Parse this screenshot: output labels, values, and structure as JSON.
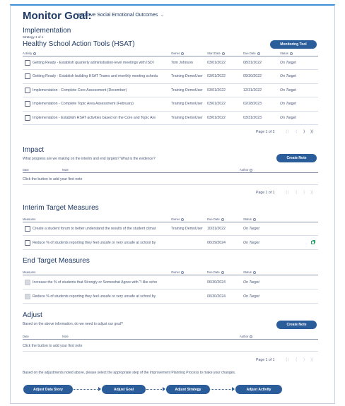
{
  "header": {
    "title": "Monitor Goal:",
    "goal": "Improve Social Emotional Outcomes",
    "chevron_icon": "chevron-down-icon"
  },
  "implementation": {
    "title": "Implementation",
    "strategy_count": "Strategy 1 of 1",
    "strategy_name": "Healthy School Action Tools (HSAT)",
    "monitoring_button": "Monitoring Tool",
    "columns": {
      "activity": "Activity",
      "owner": "Owner",
      "start": "Start Date",
      "due": "Due Date",
      "status": "Status"
    },
    "rows": [
      {
        "activity": "Getting Ready - Establish quarterly administration-level meetings with ISD l",
        "owner": "Tom Johnson",
        "start": "03/01/2022",
        "due": "08/31/2022",
        "status": "On Target"
      },
      {
        "activity": "Getting Ready - Establish building HSAT Teams and monthly meeting schedu",
        "owner": "Training DemoUser",
        "start": "03/01/2022",
        "due": "09/30/2022",
        "status": "On Target"
      },
      {
        "activity": "Implementation - Complete Core Assessment (December)",
        "owner": "Training DemoUser",
        "start": "03/01/2022",
        "due": "12/31/2022",
        "status": "On Target"
      },
      {
        "activity": "Implementation - Complete Topic Area Assessment (February)",
        "owner": "Training DemoUser",
        "start": "03/01/2022",
        "due": "02/28/2023",
        "status": "On Target"
      },
      {
        "activity": "Implementation - Establish HSAT activities based on the Core and Topic Are",
        "owner": "Training DemoUser",
        "start": "03/01/2022",
        "due": "03/31/2023",
        "status": "On Target"
      }
    ],
    "pager": "Page 1 of 2"
  },
  "impact": {
    "title": "Impact",
    "question": "What progress are we making on the interim and end targets? What is the evidence?",
    "create_button": "Create Note",
    "columns": {
      "date": "Date",
      "note": "Note",
      "author": "Author"
    },
    "empty": "Click the button to add your first note",
    "pager": "Page 1 of 1"
  },
  "interim": {
    "title": "Interim Target Measures",
    "columns": {
      "measure": "Measures",
      "owner": "Owner",
      "due": "Due Date",
      "status": "Status"
    },
    "rows": [
      {
        "measure": "Create a student forum to better understand the results of the student climat",
        "owner": "Training DemoUser",
        "due": "10/31/2022",
        "status": "On Target"
      },
      {
        "measure": "Reduce % of students reporting they feel unsafe or very unsafe at school by",
        "owner": "",
        "due": "06/29/2024",
        "status": "On Target"
      }
    ]
  },
  "end": {
    "title": "End Target Measures",
    "columns": {
      "measure": "Measures",
      "owner": "Owner",
      "due": "Due Date",
      "status": "Status"
    },
    "rows": [
      {
        "measure": "Increase the % of students that Strongly or Somewhat Agree with \"I like scho",
        "owner": "",
        "due": "06/30/2024",
        "status": "On Target"
      },
      {
        "measure": "Reduce % of students reporting they feel unsafe or very unsafe at school by",
        "owner": "",
        "due": "06/30/2024",
        "status": "On Target"
      }
    ]
  },
  "adjust": {
    "title": "Adjust",
    "question": "Based on the above information, do we need to adjust our goal?",
    "create_button": "Create Note",
    "columns": {
      "date": "Date",
      "note": "Note",
      "author": "Author"
    },
    "empty": "Click the button to add your first note",
    "pager": "Page 1 of 1",
    "instructions": "Based on the adjustments noted above, please select the appropriate step of the Improvement Planning Process to make your changes."
  },
  "flow": [
    "Adjust Data Story",
    "Adjust Goal",
    "Adjust Strategy",
    "Adjust Activity"
  ],
  "colors": {
    "accent": "#2b5d9b",
    "title": "#1f3a64",
    "success": "#2ea56a"
  }
}
